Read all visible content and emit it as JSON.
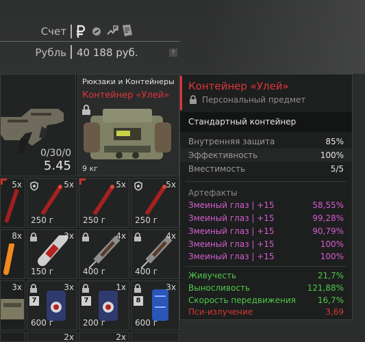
{
  "account": {
    "label": "Счет",
    "currency_label": "Рубль",
    "balance": "40 188 руб.",
    "currency_icons": [
      "ruble-icon",
      "coin-icon",
      "exchange-icon",
      "document-icon"
    ],
    "help": "?"
  },
  "inventory": {
    "weapon": {
      "ammo": "0/30/0",
      "weight": "5.45"
    },
    "slots": [
      {
        "count": "5x",
        "weight": ""
      },
      {
        "count": "5x",
        "weight": "250 г"
      },
      {
        "count": "5x",
        "weight": "250 г"
      },
      {
        "count": "5x",
        "weight": "250 г"
      },
      {
        "count": "8x",
        "weight": ""
      },
      {
        "count": "3x",
        "weight": "150 г"
      },
      {
        "count": "4x",
        "weight": "400 г"
      },
      {
        "count": "4x",
        "weight": "400 г"
      },
      {
        "count": "3x",
        "weight": ""
      },
      {
        "count": "3x",
        "weight": "600 г",
        "badge": "7"
      },
      {
        "count": "1x",
        "weight": "200 г",
        "badge": "7"
      },
      {
        "count": "3x",
        "weight": "600 г",
        "badge": "8"
      },
      {
        "count": "2x",
        "weight": ""
      },
      {
        "count": "2x",
        "weight": ""
      }
    ]
  },
  "selected_card": {
    "category": "Рюкзаки и Контейнеры",
    "name": "Контейнер «Улей»",
    "weight": "9 кг"
  },
  "tooltip": {
    "title": "Контейнер «Улей»",
    "subtitle": "Персональный предмет",
    "description": "Стандартный контейнер",
    "stats": [
      {
        "label": "Внутренняя защита",
        "value": "85%"
      },
      {
        "label": "Эффективность",
        "value": "100%"
      },
      {
        "label": "Вместимость",
        "value": "5/5"
      }
    ],
    "artifacts_header": "Артефакты",
    "artifacts": [
      {
        "label": "Змеиный глаз | +15",
        "value": "58,55%"
      },
      {
        "label": "Змеиный глаз | +15",
        "value": "99,28%"
      },
      {
        "label": "Змеиный глаз | +15",
        "value": "90,79%"
      },
      {
        "label": "Змеиный глаз | +15",
        "value": "100%"
      },
      {
        "label": "Змеиный глаз | +15",
        "value": "100%"
      }
    ],
    "effects": [
      {
        "label": "Живучесть",
        "value": "21,7%",
        "color": "#4fc94a"
      },
      {
        "label": "Выносливость",
        "value": "121,88%",
        "color": "#4fc94a"
      },
      {
        "label": "Скорость передвижения",
        "value": "16,7%",
        "color": "#4fc94a"
      },
      {
        "label": "Пси-излучение",
        "value": "3,69",
        "color": "#d43a35"
      }
    ]
  },
  "colors": {
    "rarity_red": "#e0353b",
    "artifact_pink": "#d45fd0",
    "positive": "#4fc94a",
    "negative": "#d43a35"
  }
}
